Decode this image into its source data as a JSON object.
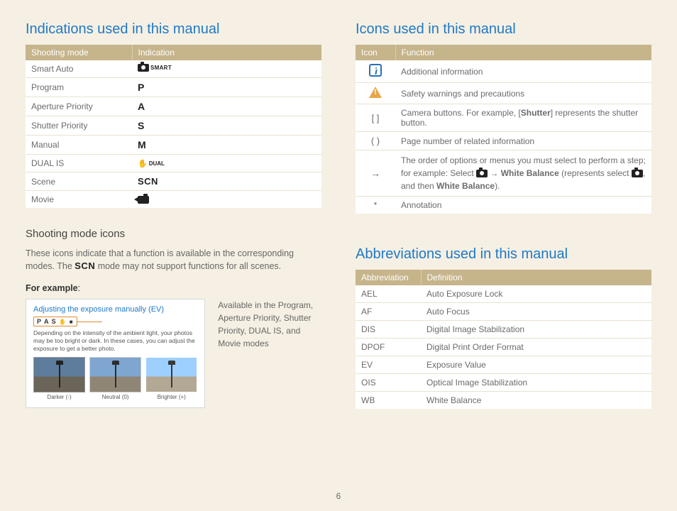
{
  "page_number": "6",
  "left": {
    "heading": "Indications used in this manual",
    "table": {
      "headers": [
        "Shooting mode",
        "Indication"
      ],
      "rows": [
        {
          "mode": "Smart Auto",
          "glyph": "smart"
        },
        {
          "mode": "Program",
          "glyph": "P"
        },
        {
          "mode": "Aperture Priority",
          "glyph": "A"
        },
        {
          "mode": "Shutter Priority",
          "glyph": "S"
        },
        {
          "mode": "Manual",
          "glyph": "M"
        },
        {
          "mode": "DUAL IS",
          "glyph": "dual"
        },
        {
          "mode": "Scene",
          "glyph": "SCN"
        },
        {
          "mode": "Movie",
          "glyph": "movie"
        }
      ]
    },
    "sub_heading": "Shooting mode icons",
    "body_pre": "These icons indicate that a function is available in the corresponding modes. The ",
    "body_mid": "SCN",
    "body_post": " mode may not support functions for all scenes.",
    "for_example": "For example",
    "example": {
      "title": "Adjusting the exposure manually (EV)",
      "strip": "P A S",
      "desc": "Depending on the intensity of the ambient light, your photos may be too bright or dark. In these cases, you can adjust the exposure to get a better photo.",
      "thumbs": [
        "Darker (-)",
        "Neutral (0)",
        "Brighter (+)"
      ],
      "caption": "Available in the Program, Aperture Priority, Shutter Priority, DUAL IS, and Movie modes"
    }
  },
  "right_icons": {
    "heading": "Icons used in this manual",
    "headers": [
      "Icon",
      "Function"
    ],
    "rows": {
      "info": "Additional information",
      "warn": "Safety warnings and precautions",
      "brackets_sym": "[  ]",
      "brackets_pre": "Camera buttons. For example, [",
      "brackets_bold": "Shutter",
      "brackets_post": "] represents the shutter button.",
      "paren_sym": "(  )",
      "paren": "Page number of related information",
      "arrow_sym": "→",
      "arrow_l1": "The order of options or menus you must select to perform a step; for example: Select ",
      "arrow_l2": " → ",
      "arrow_b1": "White Balance",
      "arrow_l3": " (represents select ",
      "arrow_l4": ", and then ",
      "arrow_b2": "White Balance",
      "arrow_l5": ").",
      "star_sym": "*",
      "star": "Annotation"
    }
  },
  "right_abbr": {
    "heading": "Abbreviations used in this manual",
    "headers": [
      "Abbreviation",
      "Definition"
    ],
    "rows": [
      {
        "a": "AEL",
        "d": "Auto Exposure Lock"
      },
      {
        "a": "AF",
        "d": "Auto Focus"
      },
      {
        "a": "DIS",
        "d": "Digital Image Stabilization"
      },
      {
        "a": "DPOF",
        "d": "Digital Print Order Format"
      },
      {
        "a": "EV",
        "d": "Exposure Value"
      },
      {
        "a": "OIS",
        "d": "Optical Image Stabilization"
      },
      {
        "a": "WB",
        "d": "White Balance"
      }
    ]
  }
}
